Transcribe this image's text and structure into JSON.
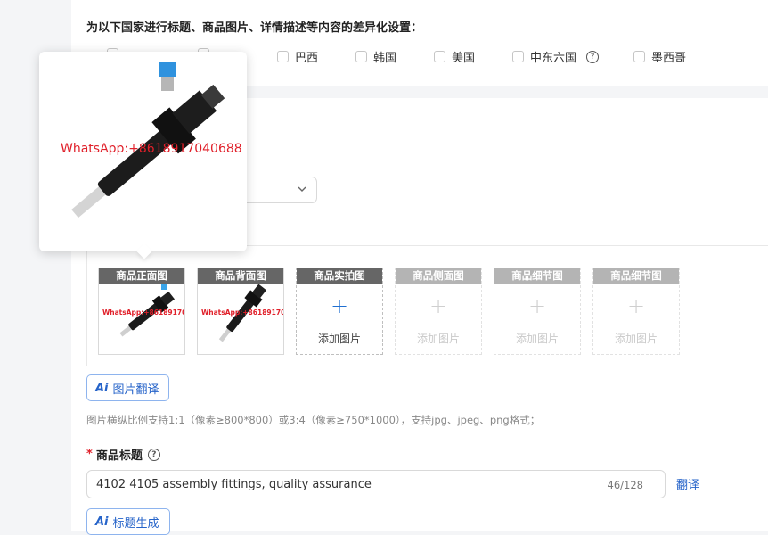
{
  "settings": {
    "heading": "为以下国家进行标题、商品图片、详情描述等内容的差异化设置：",
    "countries": [
      "巴西",
      "韩国",
      "美国",
      "中东六国",
      "墨西哥"
    ],
    "help_mark": "?"
  },
  "images": {
    "watermark": "WhatsApp:+8618917040688",
    "slots": [
      {
        "label": "商品正面图",
        "state": "filled"
      },
      {
        "label": "商品背面图",
        "state": "filled"
      },
      {
        "label": "商品实拍图",
        "state": "add",
        "add_text": "添加图片"
      },
      {
        "label": "商品侧面图",
        "state": "disabled",
        "add_text": "添加图片"
      },
      {
        "label": "商品细节图",
        "state": "disabled",
        "add_text": "添加图片"
      },
      {
        "label": "商品细节图",
        "state": "disabled",
        "add_text": "添加图片"
      }
    ],
    "translate_button": "图片翻译",
    "ai_mark": "Ai",
    "hint": "图片横纵比例支持1:1（像素≥800*800）或3:4（像素≥750*1000），支持jpg、jpeg、png格式；"
  },
  "product_title": {
    "required_mark": "*",
    "label": "商品标题",
    "value": "4102 4105 assembly fittings, quality assurance",
    "count": "46/128",
    "translate_link": "翻译",
    "generate_button": "标题生成"
  },
  "colors": {
    "accent": "#2563c9",
    "watermark": "#e0202a",
    "slot_label_bg": "#666666"
  },
  "icons": [
    "question-circle-icon",
    "chevron-down-icon",
    "plus-icon",
    "ai-icon",
    "product-photo"
  ]
}
